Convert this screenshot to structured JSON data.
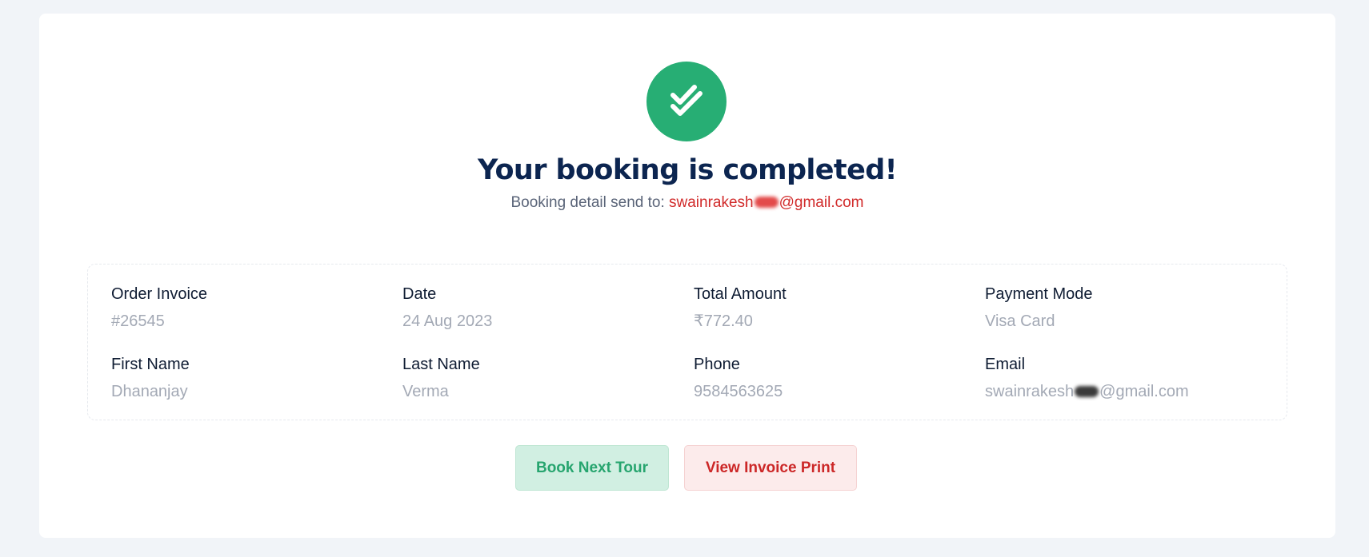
{
  "confirmation": {
    "icon": "double-check-icon",
    "title": "Your booking is completed!",
    "sent_prefix": "Booking detail send to:",
    "email_start": "swainrakesh",
    "email_end": "@gmail.com"
  },
  "details": {
    "order_invoice": {
      "label": "Order Invoice",
      "value": "#26545"
    },
    "date": {
      "label": "Date",
      "value": "24 Aug 2023"
    },
    "total_amount": {
      "label": "Total Amount",
      "value": "₹772.40"
    },
    "payment_mode": {
      "label": "Payment Mode",
      "value": "Visa Card"
    },
    "first_name": {
      "label": "First Name",
      "value": "Dhananjay"
    },
    "last_name": {
      "label": "Last Name",
      "value": "Verma"
    },
    "phone": {
      "label": "Phone",
      "value": "9584563625"
    },
    "email": {
      "label": "Email",
      "value_start": "swainrakesh",
      "value_end": "@gmail.com"
    }
  },
  "actions": {
    "book_next": "Book Next Tour",
    "view_invoice": "View Invoice Print"
  },
  "colors": {
    "success": "#27ae74",
    "heading": "#0c2550",
    "danger": "#d12a2a",
    "muted": "#a3a9b5",
    "background": "#f1f4f8"
  }
}
